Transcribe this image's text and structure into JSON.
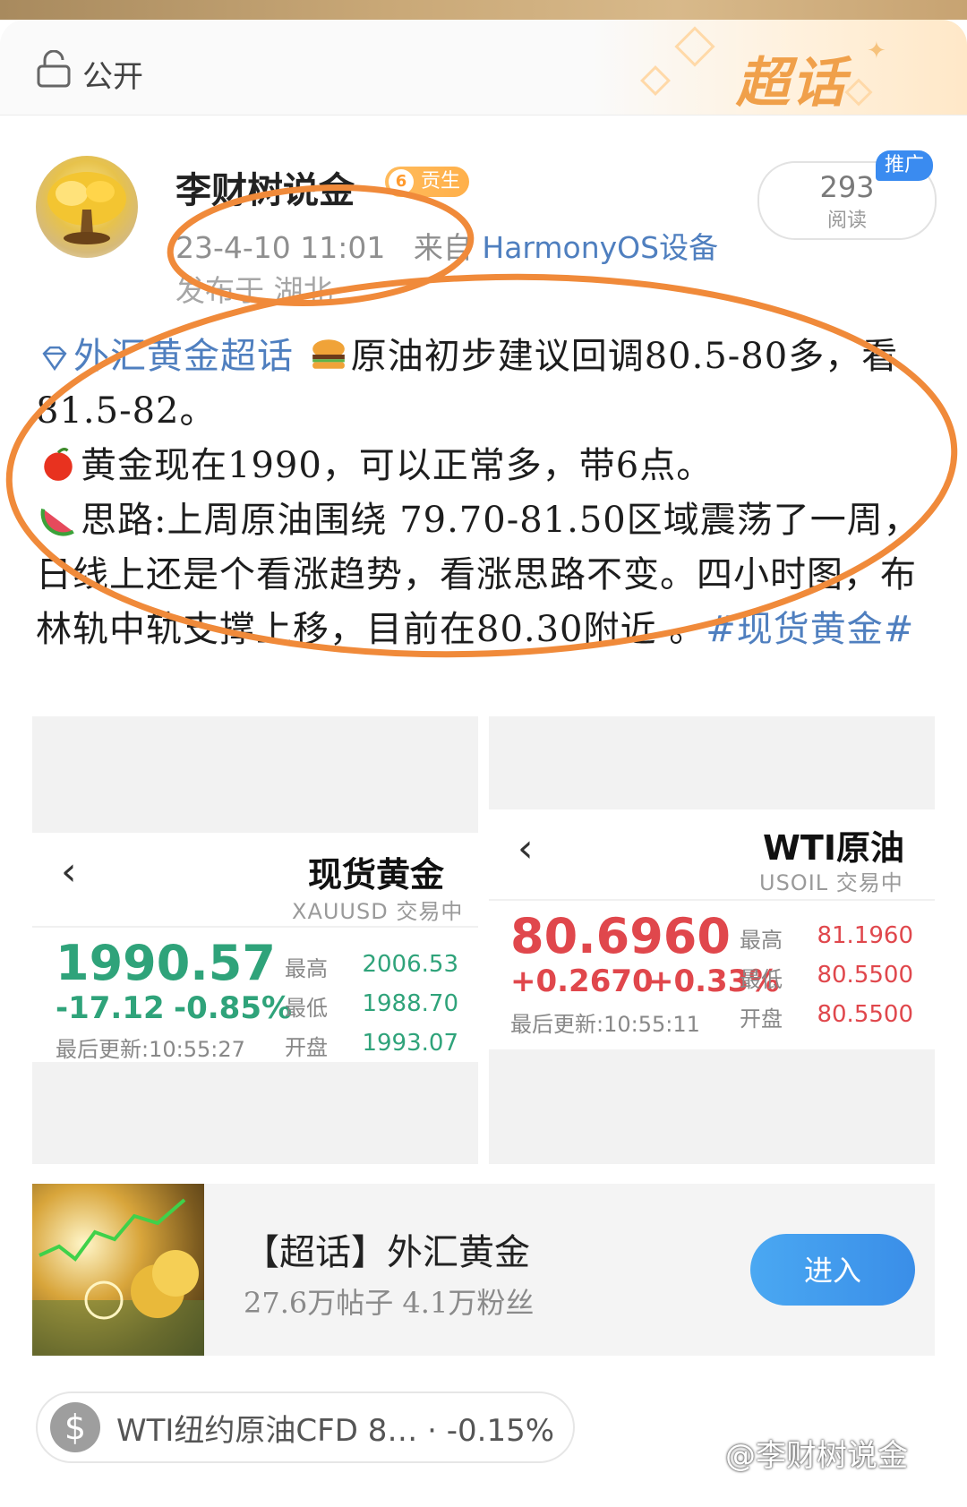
{
  "header": {
    "visibility_label": "公开",
    "topic_brand": "超话"
  },
  "author": {
    "name": "李财树说金",
    "level": "6",
    "badge_label": "贡生",
    "timestamp": "23-4-10 11:01",
    "source_prefix": "来自",
    "source": "HarmonyOS设备",
    "location": "发布于 湖北"
  },
  "stats": {
    "read_count": "293",
    "read_label": "阅读",
    "promo_label": "推广"
  },
  "post": {
    "topic_tag": "外汇黄金超话",
    "line1": "原油初步建议回调80.5-80多，看81.5-82。",
    "line2": "黄金现在1990，可以正常多，带6点。",
    "line3": "思路:上周原油围绕 79.70-81.50区域震荡了一周，日线上还是个看涨趋势，看涨思路不变。四小时图，布林轨中轨支撑上移，目前在80.30附近 。",
    "hashtag": "#现货黄金#"
  },
  "quotes": [
    {
      "title": "现货黄金",
      "subtitle": "XAUUSD 交易中",
      "price": "1990.57",
      "change": "-17.12",
      "change_pct": "-0.85%",
      "updated": "最后更新:10:55:27",
      "high_label": "最高",
      "high": "2006.53",
      "low_label": "最低",
      "low": "1988.70",
      "open_label": "开盘",
      "open": "1993.07"
    },
    {
      "title": "WTI原油",
      "subtitle": "USOIL 交易中",
      "price": "80.6960",
      "change": "+0.2670",
      "change_pct": "+0.33%",
      "updated": "最后更新:10:55:11",
      "high_label": "最高",
      "high": "81.1960",
      "low_label": "最低",
      "low": "80.5500",
      "open_label": "开盘",
      "open": "80.5500"
    }
  ],
  "topic_card": {
    "name": "【超话】外汇黄金",
    "stats": "27.6万帖子 4.1万粉丝",
    "enter_label": "进入"
  },
  "stock_pill": {
    "text": "WTI纽约原油CFD 8… · -0.15%"
  },
  "watermark": "@李财树说金",
  "colors": {
    "annotation_orange": "#f08a3a",
    "price_up": "#e0474c",
    "price_down": "#2fa37a",
    "link_blue": "#4f7fbf"
  }
}
